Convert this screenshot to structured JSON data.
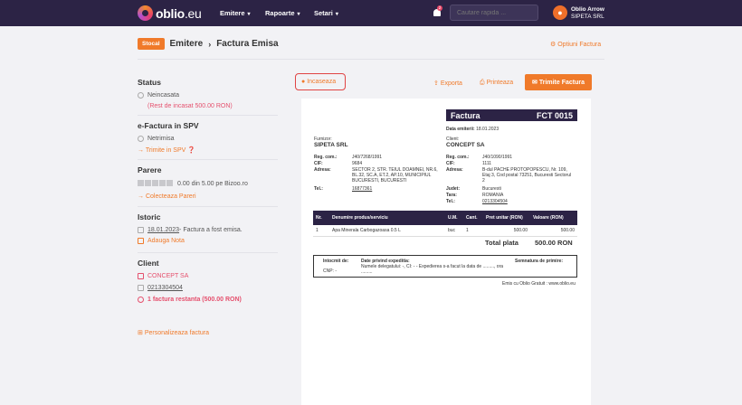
{
  "nav": {
    "logo": "oblio",
    "logo_suffix": ".eu",
    "menu": [
      "Emitere",
      "Rapoarte",
      "Setari"
    ],
    "notif_count": "2",
    "search_placeholder": "Cautare rapida ...",
    "user_name": "Oblio Arrow",
    "user_company": "SIPETA SRL"
  },
  "header": {
    "tag": "Stocal",
    "crumb1": "Emitere",
    "crumb2": "Factura Emisa",
    "options": "Optiuni Factura"
  },
  "sidebar": {
    "status_title": "Status",
    "status_value": "Neincasata",
    "status_rest": "(Rest de incasat 500.00 RON)",
    "spv_title": "e-Factura in SPV",
    "spv_value": "Netrimisa",
    "spv_action": "Trimite in SPV",
    "parere_title": "Parere",
    "parere_value": "0.00 din 5.00 pe Bizoo.ro",
    "parere_action": "Colecteaza Pareri",
    "istoric_title": "Istoric",
    "istoric_date": "18.01.2023",
    "istoric_text": " - Factura a fost emisa.",
    "istoric_action": "Adauga Nota",
    "client_title": "Client",
    "client_name": "CONCEPT SA",
    "client_phone": "0213304504",
    "client_overdue": "1 factura restanta (500.00 RON)",
    "personalize": "Personalizeaza factura"
  },
  "toolbar": {
    "incaseaza": "Incaseaza",
    "exporta": "Exporta",
    "printeaza": "Printeaza",
    "trimite": "Trimite Factura"
  },
  "invoice": {
    "title": "Factura",
    "number": "FCT 0015",
    "date_label": "Data emiterii:",
    "date": "18.01.2023",
    "supplier_label": "Furnizor:",
    "supplier_name": "SIPETA SRL",
    "supplier_reg": "J40/7268/1991",
    "supplier_cif": "9684",
    "supplier_address": "SECTOR 2, STR. TEIUL DOAMNEI, NR.6, BL.32, SC.A, ET.2, AP.10, MUNICIPIUL BUCURESTI, BUCURESTI",
    "supplier_tel": "16877361",
    "client_label": "Client:",
    "client_name": "CONCEPT SA",
    "client_reg": "J40/1090/1991",
    "client_cif": "1111",
    "client_address": "B-dul PACHE PROTOPOPESCU, Nr. 109, Etaj 3, Cod postal 73251, Bucuresti Sectorul 2",
    "client_judet": "Bucuresti",
    "client_tara": "ROMANIA",
    "client_tel": "0213304504",
    "lbl_reg": "Reg. com.:",
    "lbl_cif": "CIF:",
    "lbl_adresa": "Adresa:",
    "lbl_tel": "Tel.:",
    "lbl_judet": "Judet:",
    "lbl_tara": "Tara:",
    "columns": [
      "Nr.",
      "Denumire produs/serviciu",
      "U.M.",
      "Cant.",
      "Pret unitar (RON)",
      "Valoare (RON)"
    ],
    "items": [
      {
        "nr": "1",
        "name": "Apa Minerala Carbogazoasa 0.5 L",
        "um": "buc",
        "qty": "1",
        "price": "500.00",
        "value": "500.00"
      }
    ],
    "total_label": "Total plata",
    "total": "500.00 RON",
    "intocmit": "Intocmit de:",
    "cnp": "CNP: -",
    "expeditie_title": "Date privind expeditia:",
    "expeditie_text": "Numele delegatului: -, CI: - - Expedierea s-a facut la data de ........., ora .........",
    "semnatura": "Semnatura de primire:",
    "footer": "Emis cu Oblio Gratuit : www.oblio.eu"
  },
  "colors": {
    "nav": "#2c2345",
    "accent": "#f07a2a",
    "danger": "#e5506d"
  }
}
